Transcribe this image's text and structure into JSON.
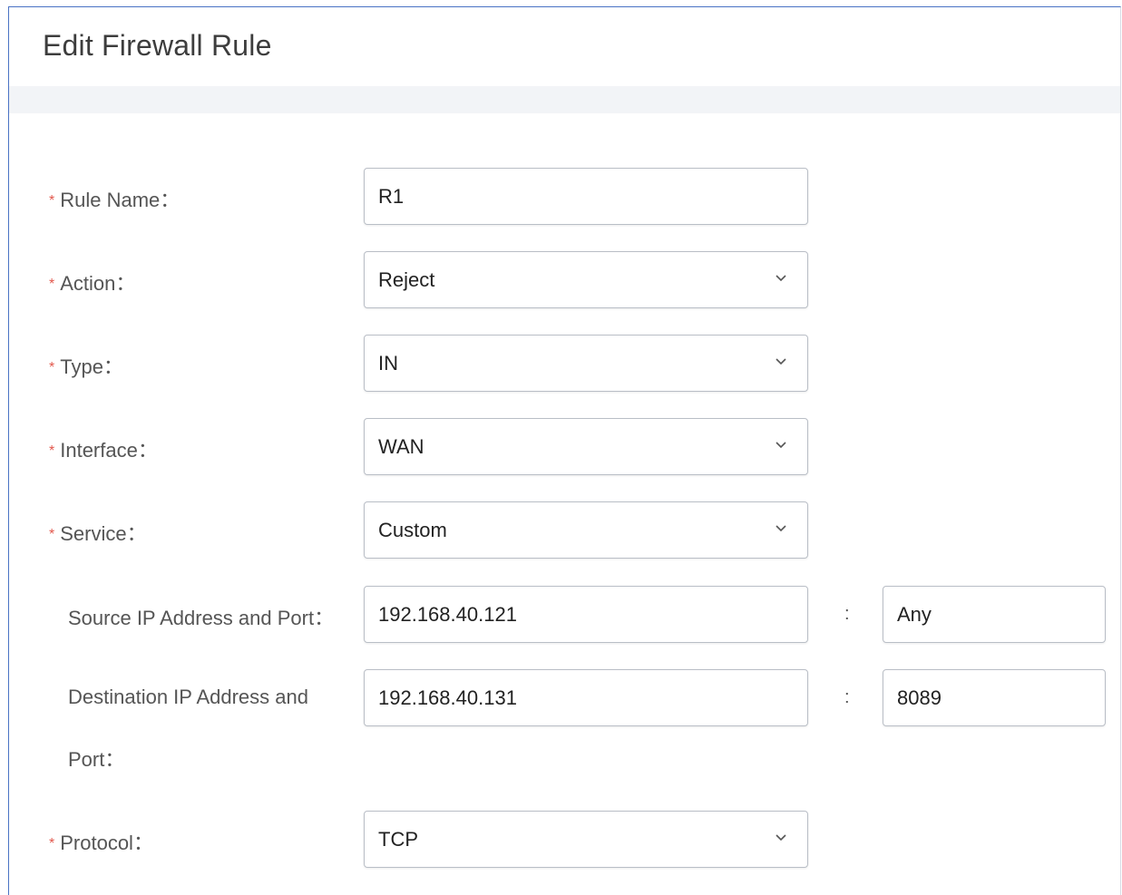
{
  "dialog": {
    "title": "Edit Firewall Rule"
  },
  "form": {
    "rule_name": {
      "label": "Rule Name：",
      "value": "R1",
      "required": true
    },
    "action": {
      "label": "Action：",
      "value": "Reject",
      "required": true
    },
    "type": {
      "label": "Type：",
      "value": "IN",
      "required": true
    },
    "interface": {
      "label": "Interface：",
      "value": "WAN",
      "required": true
    },
    "service": {
      "label": "Service：",
      "value": "Custom",
      "required": true
    },
    "source": {
      "label": "Source IP Address and Port：",
      "ip": "192.168.40.121",
      "separator": ":",
      "port": "Any",
      "required": false
    },
    "destination": {
      "label_line1": "Destination IP Address and",
      "label_line2": "Port：",
      "ip": "192.168.40.131",
      "separator": ":",
      "port": "8089",
      "required": false
    },
    "protocol": {
      "label": "Protocol：",
      "value": "TCP",
      "required": true
    },
    "required_marker": "*"
  },
  "icons": {
    "select_arrow": "chevron-down-icon"
  },
  "colors": {
    "border_accent": "#4a72c4",
    "required_marker": "#e2574c",
    "label_text": "#555555",
    "input_border": "#b9bec6"
  }
}
